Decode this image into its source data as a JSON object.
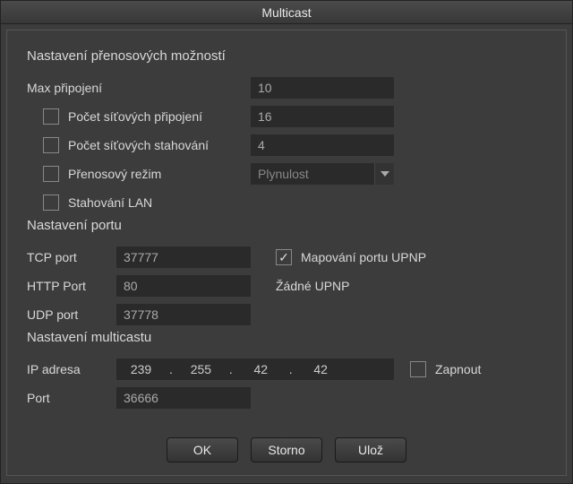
{
  "window": {
    "title": "Multicast"
  },
  "transfer": {
    "title": "Nastavení přenosových možností",
    "max_conn_label": "Max připojení",
    "max_conn_value": "10",
    "net_conn_label": "Počet síťových připojení",
    "net_conn_value": "16",
    "net_dl_label": "Počet síťových stahování",
    "net_dl_value": "4",
    "mode_label": "Přenosový režim",
    "mode_value": "Plynulost",
    "lan_dl_label": "Stahování LAN"
  },
  "port": {
    "title": "Nastavení portu",
    "tcp_label": "TCP port",
    "tcp_value": "37777",
    "http_label": "HTTP Port",
    "http_value": "80",
    "udp_label": "UDP port",
    "udp_value": "37778",
    "upnp_map_label": "Mapování portu UPNP",
    "upnp_status": "Žádné UPNP"
  },
  "multicast": {
    "title": "Nastavení multicastu",
    "ip_label": "IP adresa",
    "ip": {
      "o1": "239",
      "o2": "255",
      "o3": "42",
      "o4": "42"
    },
    "enable_label": "Zapnout",
    "port_label": "Port",
    "port_value": "36666"
  },
  "buttons": {
    "ok": "OK",
    "cancel": "Storno",
    "save": "Ulož"
  }
}
